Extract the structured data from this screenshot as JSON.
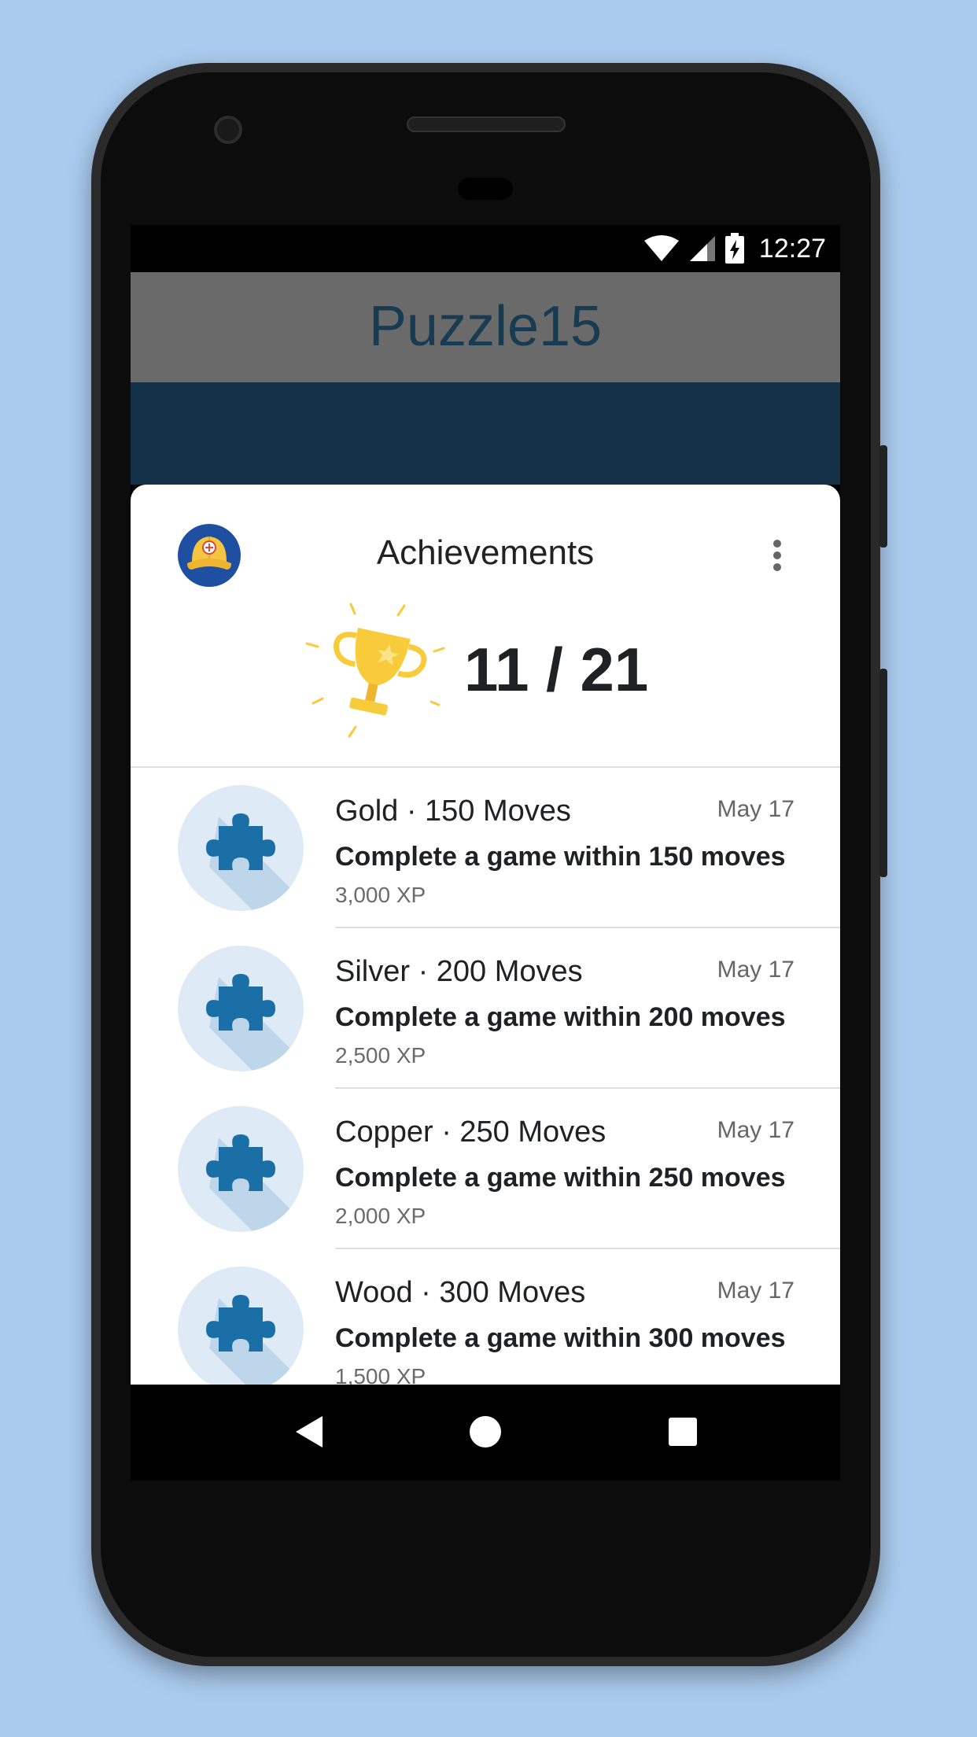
{
  "status_bar": {
    "time": "12:27",
    "icons": [
      "wifi-icon",
      "signal-icon",
      "battery-charging-icon"
    ]
  },
  "app": {
    "title": "Puzzle15"
  },
  "achievements_sheet": {
    "title": "Achievements",
    "score": "11 / 21",
    "avatar_icon": "cap-avatar-icon",
    "menu_icon": "more-vert-icon",
    "trophy_icon": "trophy-icon"
  },
  "achievements": [
    {
      "name": "Gold · 150 Moves",
      "description": "Complete a game within 150 moves",
      "xp": "3,000 XP",
      "date": "May 17",
      "icon": "puzzle-piece-icon"
    },
    {
      "name": "Silver · 200 Moves",
      "description": "Complete a game within 200 moves",
      "xp": "2,500 XP",
      "date": "May 17",
      "icon": "puzzle-piece-icon"
    },
    {
      "name": "Copper · 250 Moves",
      "description": "Complete a game within 250 moves",
      "xp": "2,000 XP",
      "date": "May 17",
      "icon": "puzzle-piece-icon"
    },
    {
      "name": "Wood · 300 Moves",
      "description": "Complete a game within 300 moves",
      "xp": "1,500 XP",
      "date": "May 17",
      "icon": "puzzle-piece-icon"
    }
  ],
  "nav": {
    "back_icon": "back-icon",
    "home_icon": "home-icon",
    "recents_icon": "recents-icon"
  },
  "colors": {
    "background": "#aacbee",
    "appbar": "#6a6a6a",
    "title_text": "#183b52",
    "dark_band": "#143147",
    "puzzle_blue": "#1a6fa6",
    "icon_circle": "#deebf7",
    "trophy_yellow": "#f7cb3a"
  }
}
